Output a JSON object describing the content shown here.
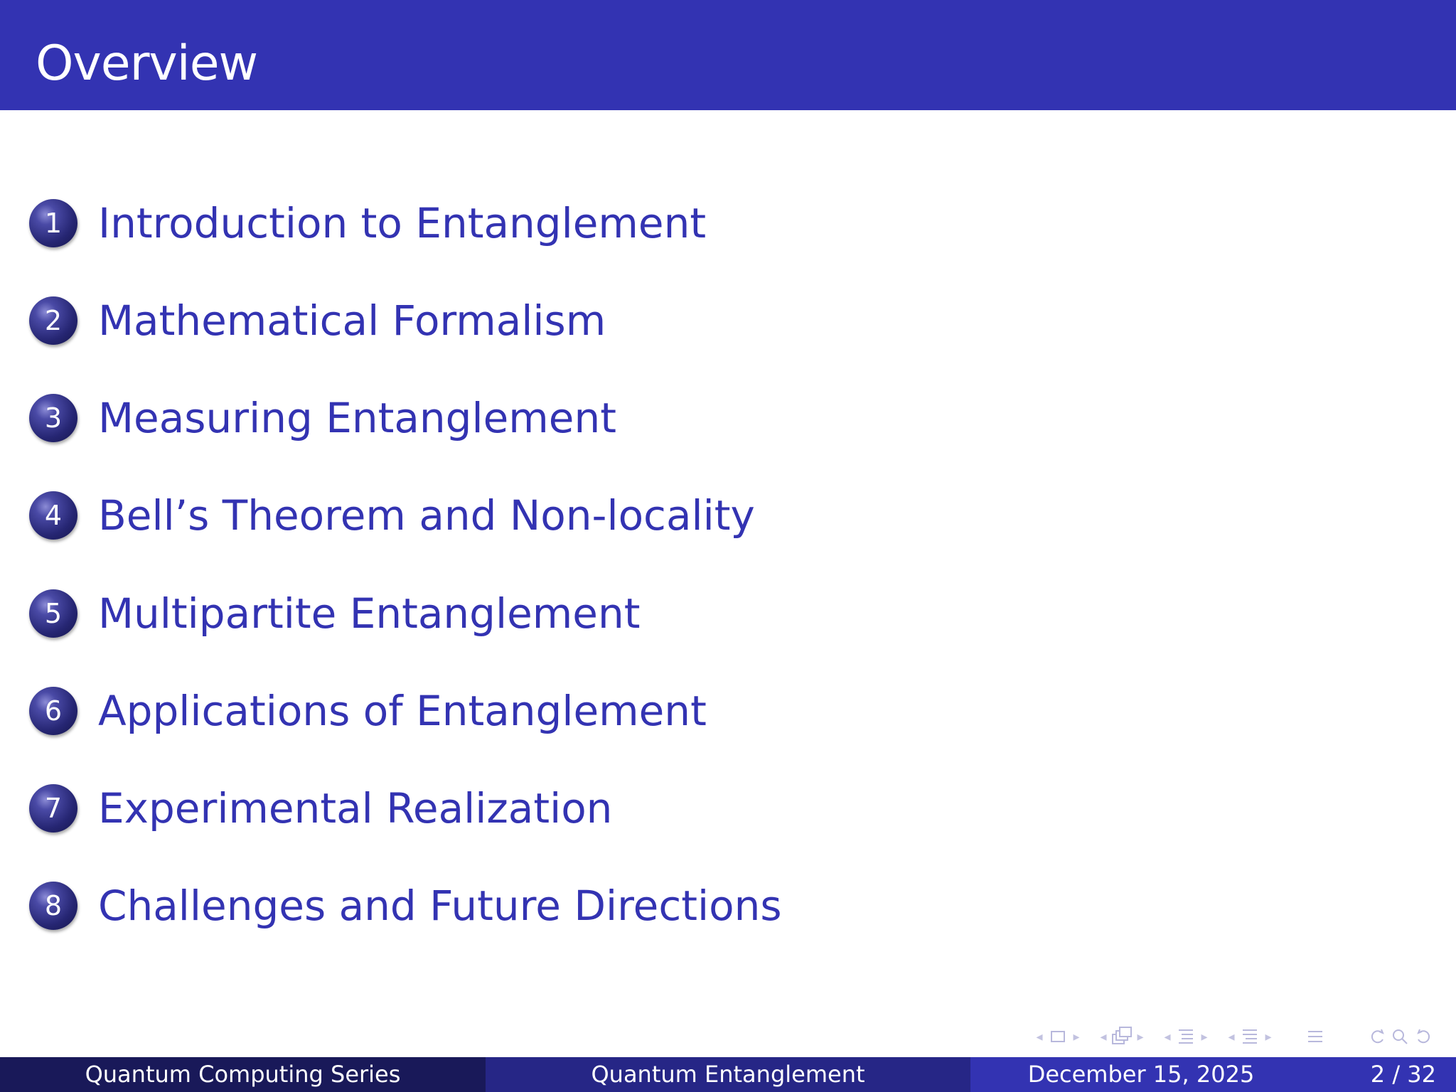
{
  "frame": {
    "title": "Overview"
  },
  "toc": {
    "items": [
      {
        "number": "1",
        "label": "Introduction to Entanglement"
      },
      {
        "number": "2",
        "label": "Mathematical Formalism"
      },
      {
        "number": "3",
        "label": "Measuring Entanglement"
      },
      {
        "number": "4",
        "label": "Bell’s Theorem and Non-locality"
      },
      {
        "number": "5",
        "label": "Multipartite Entanglement"
      },
      {
        "number": "6",
        "label": "Applications of Entanglement"
      },
      {
        "number": "7",
        "label": "Experimental Realization"
      },
      {
        "number": "8",
        "label": "Challenges and Future Directions"
      }
    ]
  },
  "footer": {
    "author": "Quantum Computing Series",
    "title": "Quantum Entanglement",
    "date": "December 15, 2025",
    "page": "2 / 32"
  },
  "navigation": {
    "icons": [
      "frame-nav-icon",
      "subsection-nav-icon",
      "section-nav-icon",
      "subsection-alt-nav-icon",
      "appendix-nav-icon",
      "search-nav-icon"
    ]
  },
  "colors": {
    "primary": "#3333b2",
    "footer_dark": "#191959",
    "footer_mid": "#262686"
  }
}
